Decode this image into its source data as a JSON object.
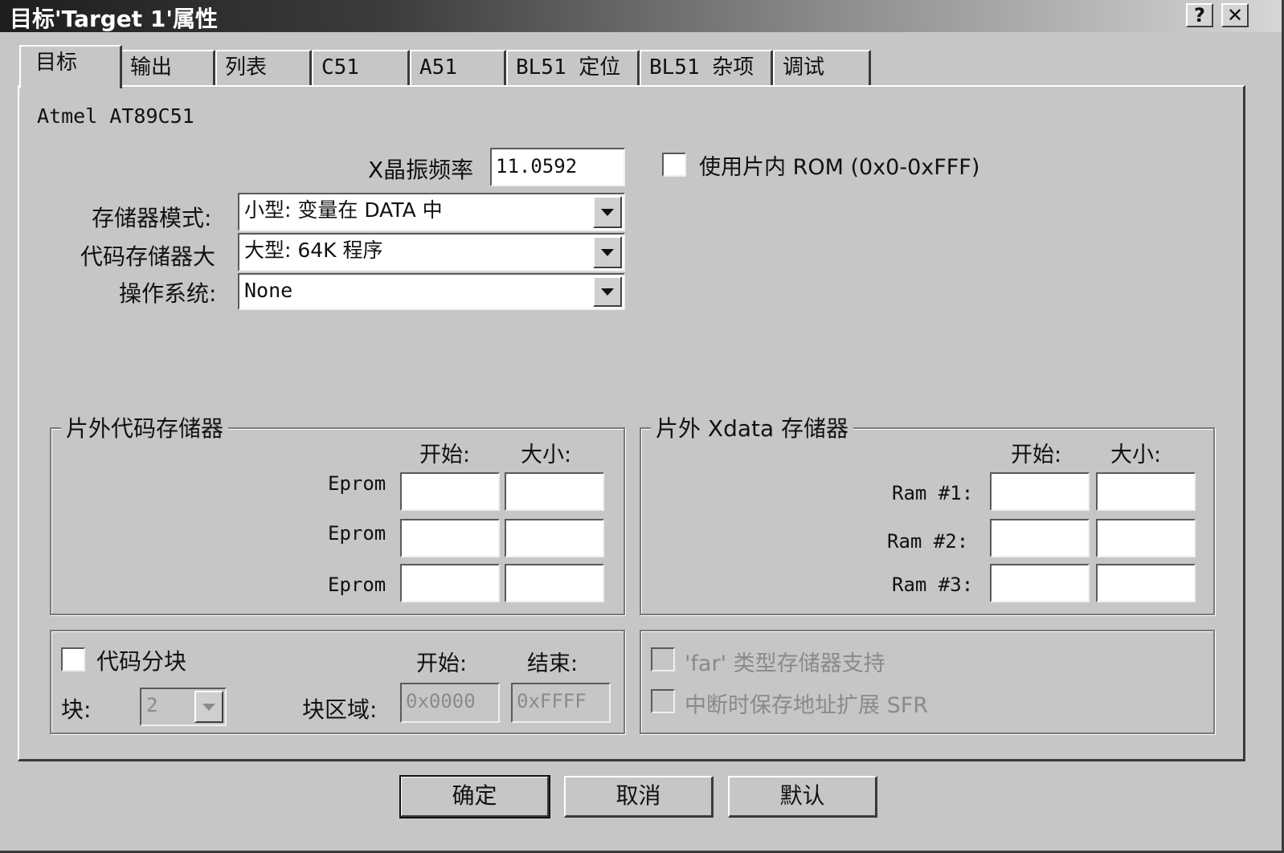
{
  "window": {
    "title": "目标'Target 1'属性",
    "help_label": "?",
    "close_label": "✕"
  },
  "tabs": [
    {
      "label": "目标"
    },
    {
      "label": "输出"
    },
    {
      "label": "列表"
    },
    {
      "label": "C51"
    },
    {
      "label": "A51"
    },
    {
      "label": "BL51 定位"
    },
    {
      "label": "BL51 杂项"
    },
    {
      "label": "调试"
    }
  ],
  "target": {
    "device": "Atmel AT89C51",
    "xtal_label": "X晶振频率",
    "xtal_value": "11.0592",
    "use_onchip_rom_label": "使用片内 ROM (0x0-0xFFF)",
    "memory_model_label": "存储器模式:",
    "memory_model_value": "小型: 变量在 DATA 中",
    "code_rom_label": "代码存储器大",
    "code_rom_value": "大型: 64K 程序",
    "os_label": "操作系统:",
    "os_value": "None"
  },
  "offchip_code": {
    "title": "片外代码存储器",
    "start_header": "开始:",
    "size_header": "大小:",
    "rows": [
      {
        "label": "Eprom"
      },
      {
        "label": "Eprom"
      },
      {
        "label": "Eprom"
      }
    ]
  },
  "offchip_xdata": {
    "title": "片外 Xdata 存储器",
    "start_header": "开始:",
    "size_header": "大小:",
    "rows": [
      {
        "label": "Ram #1:"
      },
      {
        "label": "Ram #2:"
      },
      {
        "label": "Ram #3:"
      }
    ]
  },
  "banking": {
    "code_banking_label": "代码分块",
    "start_header": "开始:",
    "end_header": "结束:",
    "banks_label": "块:",
    "banks_value": "2",
    "bank_area_label": "块区域:",
    "bank_start_value": "0x0000",
    "bank_end_value": "0xFFFF"
  },
  "options": {
    "far_label": "'far' 类型存储器支持",
    "sfr_label": "中断时保存地址扩展 SFR"
  },
  "buttons": {
    "ok": "确定",
    "cancel": "取消",
    "default": "默认"
  }
}
